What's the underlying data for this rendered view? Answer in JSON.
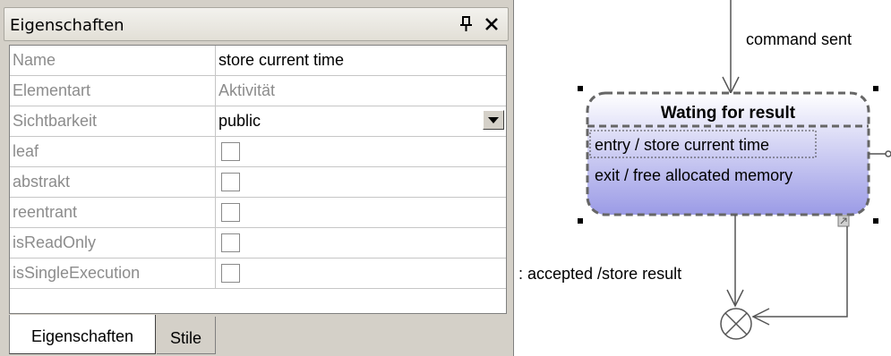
{
  "panel": {
    "title": "Eigenschaften",
    "properties": [
      {
        "name": "Name",
        "value": "store current time",
        "type": "text"
      },
      {
        "name": "Elementart",
        "value": "Aktivität",
        "type": "readonly"
      },
      {
        "name": "Sichtbarkeit",
        "value": "public",
        "type": "select"
      },
      {
        "name": "leaf",
        "value": "",
        "type": "checkbox",
        "checked": false
      },
      {
        "name": "abstrakt",
        "value": "",
        "type": "checkbox",
        "checked": false
      },
      {
        "name": "reentrant",
        "value": "",
        "type": "checkbox",
        "checked": false
      },
      {
        "name": "isReadOnly",
        "value": "",
        "type": "checkbox",
        "checked": false
      },
      {
        "name": "isSingleExecution",
        "value": "",
        "type": "checkbox",
        "checked": false
      }
    ],
    "tabs": [
      {
        "label": "Eigenschaften",
        "active": true
      },
      {
        "label": "Stile",
        "active": false
      }
    ]
  },
  "diagram": {
    "state_title": "Wating for result",
    "activities": [
      "entry / store current time",
      "exit / free allocated memory"
    ],
    "transition_top_label": "command sent",
    "transition_bottom_label": ": accepted /store result",
    "state_gradient_top": "#ffffff",
    "state_gradient_bottom": "#9b9be6"
  }
}
